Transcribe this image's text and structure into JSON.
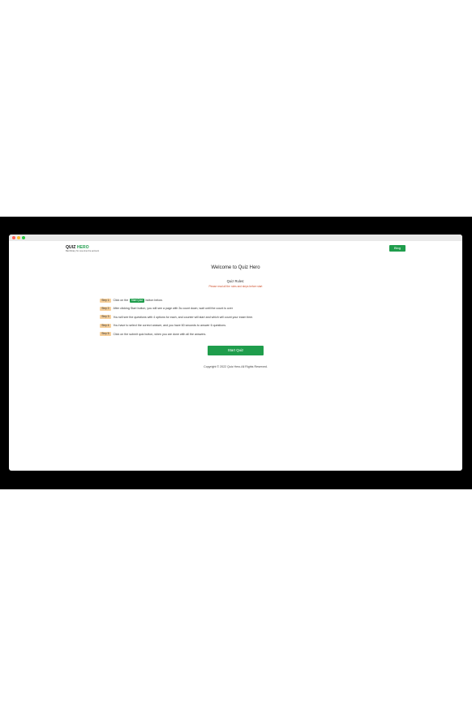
{
  "header": {
    "logo_prefix": "QUIZ",
    "logo_accent": "HERO",
    "tagline": "Bad library for one-time the account",
    "blog_label": "Blog"
  },
  "main": {
    "heading": "Welcome to Quiz Hero",
    "rules_title": "Quiz Rules:",
    "rules_note": "Please read all the rules and steps before start",
    "steps": [
      {
        "badge": "Step 1:",
        "text_before": "Click on the",
        "button": "Start Quiz",
        "text_after": "button below."
      },
      {
        "badge": "Step 2:",
        "text": "After clicking Start button, you will see a page with 3s count down, wait until the count is over"
      },
      {
        "badge": "Step 3:",
        "text": "You will see the questions with 4 options for each, and counter will start and which will count your exam time."
      },
      {
        "badge": "Step 4:",
        "text": "You have to select the correct answer, and you have 60 seconds to answer 6 questions."
      },
      {
        "badge": "Step 5:",
        "text": "Click on the submit quiz button, when you are done with all the answers."
      }
    ],
    "start_label": "Start Quiz",
    "copyright": "Copyright © 2022 Quiz Hero.All Rights Reserved."
  },
  "colors": {
    "accent": "#1f9d4c",
    "badge": "#f6cf9a",
    "note": "#d0532f"
  }
}
